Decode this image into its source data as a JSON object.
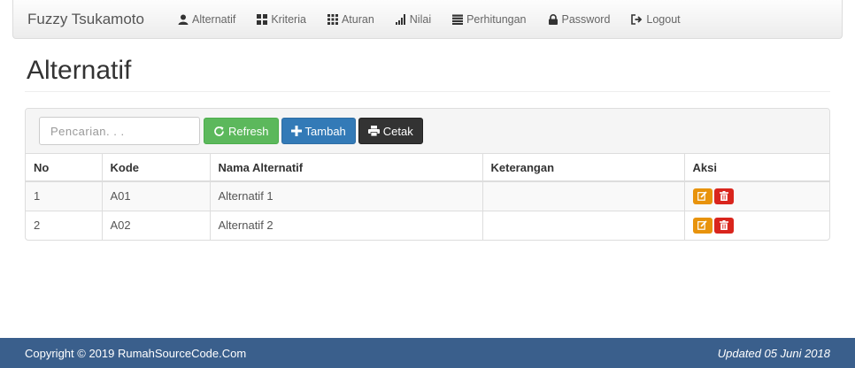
{
  "navbar": {
    "brand": "Fuzzy Tsukamoto",
    "items": [
      {
        "label": "Alternatif",
        "icon": "user-icon"
      },
      {
        "label": "Kriteria",
        "icon": "th-large-icon"
      },
      {
        "label": "Aturan",
        "icon": "grid-icon"
      },
      {
        "label": "Nilai",
        "icon": "signal-icon"
      },
      {
        "label": "Perhitungan",
        "icon": "list-icon"
      },
      {
        "label": "Password",
        "icon": "lock-icon"
      },
      {
        "label": "Logout",
        "icon": "logout-icon"
      }
    ]
  },
  "page": {
    "title": "Alternatif"
  },
  "toolbar": {
    "search_placeholder": "Pencarian. . .",
    "refresh_label": "Refresh",
    "tambah_label": "Tambah",
    "cetak_label": "Cetak"
  },
  "table": {
    "headers": [
      "No",
      "Kode",
      "Nama Alternatif",
      "Keterangan",
      "Aksi"
    ],
    "rows": [
      {
        "no": "1",
        "kode": "A01",
        "nama": "Alternatif 1",
        "keterangan": ""
      },
      {
        "no": "2",
        "kode": "A02",
        "nama": "Alternatif 2",
        "keterangan": ""
      }
    ]
  },
  "footer": {
    "copyright": "Copyright © 2019 RumahSourceCode.Com",
    "updated": "Updated 05 Juni 2018"
  },
  "colors": {
    "refresh": "#5cb85c",
    "tambah": "#337ab7",
    "cetak": "#333333",
    "edit": "#e8930c",
    "delete": "#d9251d",
    "footer": "#3a5f8c"
  }
}
